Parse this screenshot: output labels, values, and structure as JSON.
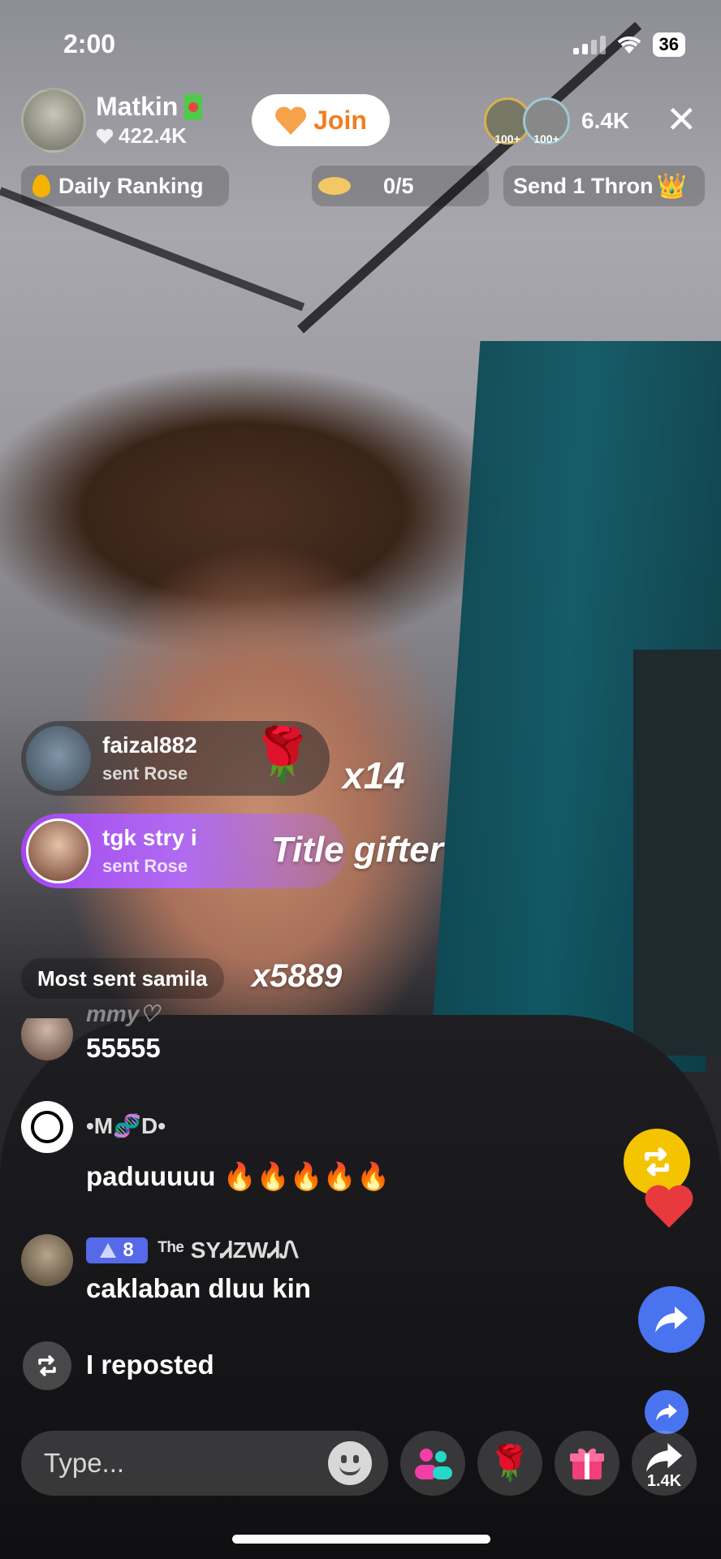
{
  "status": {
    "time": "2:00",
    "battery": "36"
  },
  "host": {
    "name": "Matkin",
    "likes": "422.4K",
    "join_label": "Join"
  },
  "viewers": {
    "badge_a": "100+",
    "badge_b": "100+",
    "count": "6.4K"
  },
  "pills": {
    "ranking": "Daily Ranking",
    "progress": "0/5",
    "send": "Send 1 Thron"
  },
  "gifts": [
    {
      "user": "faizal882",
      "action": "sent Rose",
      "multiplier": "x14"
    },
    {
      "user": "tgk stry i",
      "action": "sent Rose",
      "label": "Title gifter"
    }
  ],
  "most_sent": {
    "label": "Most sent samila",
    "multiplier": "x5889"
  },
  "chat": [
    {
      "user": "mmy♡",
      "text": "55555"
    },
    {
      "user": "•M🧬D•",
      "text": "paduuuuu 🔥🔥🔥🔥🔥"
    },
    {
      "badge": "8",
      "user": "ᵀʰᵉ SYᏗZWᏗᏁ",
      "text": "caklaban dluu kin"
    },
    {
      "text": "I reposted"
    }
  ],
  "bottom": {
    "placeholder": "Type...",
    "share_count": "1.4K"
  },
  "icons": [
    "close-icon",
    "heart-icon",
    "repost-icon",
    "share-icon",
    "gift-icon",
    "rose-icon",
    "people-icon",
    "emoji-icon"
  ],
  "colors": {
    "join": "#f27d20",
    "repost": "#f5c400",
    "share": "#4a73f0",
    "gift_highlight": "#a347f0"
  }
}
